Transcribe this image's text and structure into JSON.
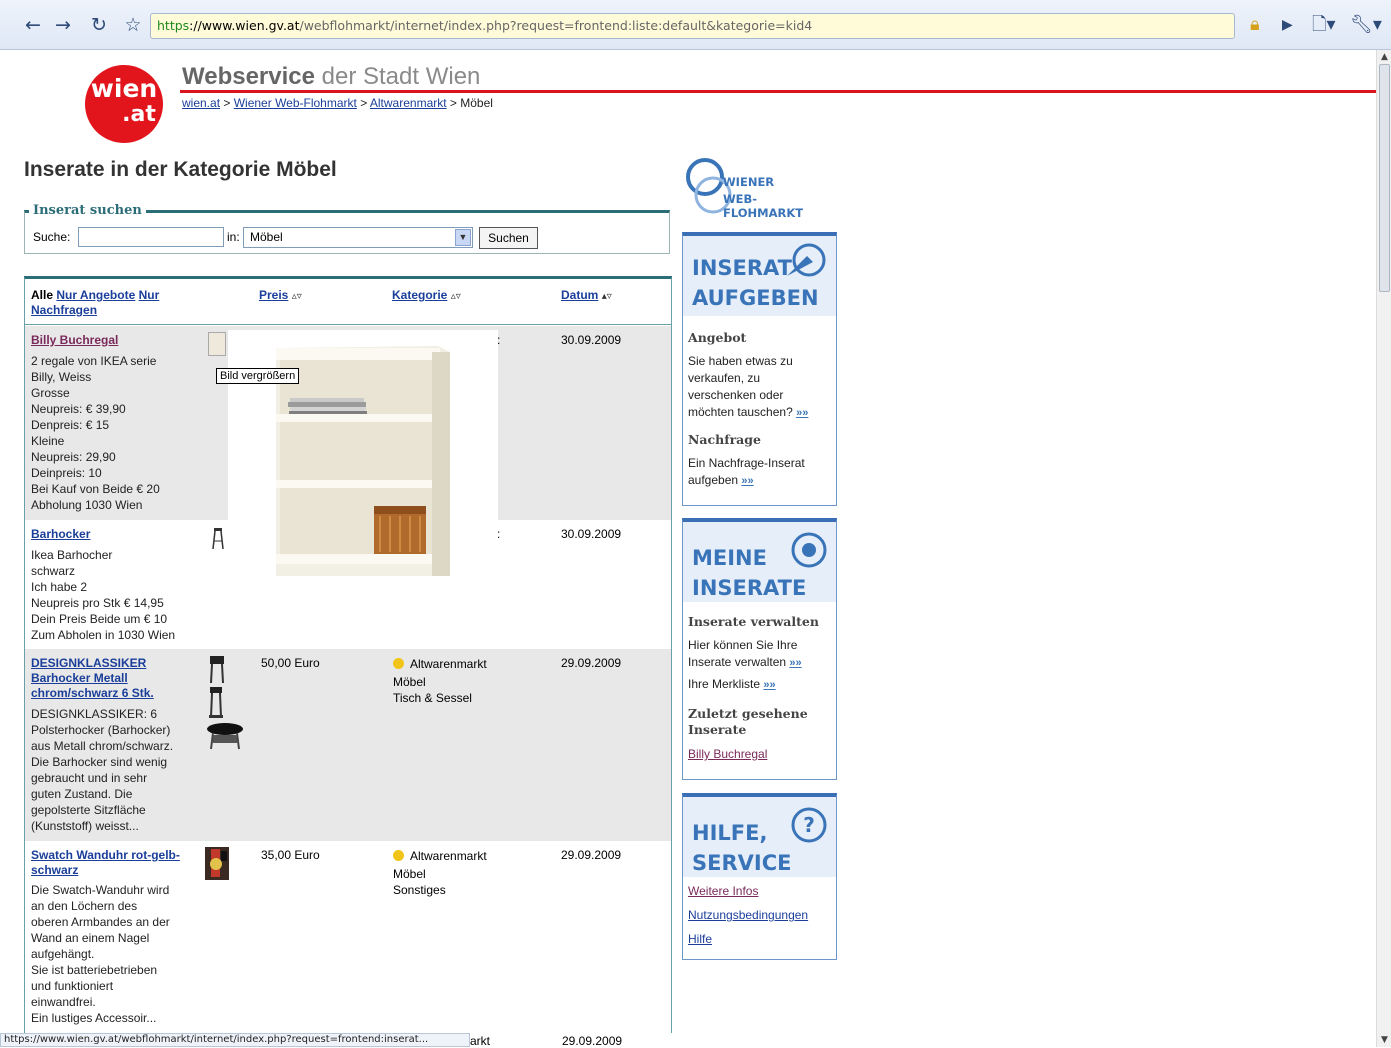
{
  "browser": {
    "url_scheme": "https",
    "url_host": "://www.wien.gv.at",
    "url_path": "/webflohmarkt/internet/index.php?request=frontend:liste:default&kategorie=kid4",
    "status_text": "https://www.wien.gv.at/webflohmarkt/internet/index.php?request=frontend:inserat..."
  },
  "header": {
    "logo_line1": "wien",
    "logo_line2": ".at",
    "title_bold": "Webservice",
    "title_rest": " der Stadt Wien",
    "breadcrumb": [
      "wien.at",
      "Wiener Web-Flohmarkt",
      "Altwarenmarkt",
      "Möbel"
    ]
  },
  "page_title": "Inserate in der Kategorie Möbel",
  "search": {
    "legend": "Inserat suchen",
    "label": "Suche:",
    "value": "",
    "in_label": "in:",
    "category": "Möbel",
    "button": "Suchen"
  },
  "listing": {
    "head": {
      "all": "Alle",
      "only_offers": "Nur Angebote",
      "only_requests": "Nur Nachfragen",
      "price": "Preis",
      "category": "Kategorie",
      "date": "Datum",
      "sort_glyph": "▵▿",
      "sort_glyph_active": "▴▿"
    },
    "rows": [
      {
        "title": "Billy Buchregal",
        "desc": "2 regale von IKEA serie\nBilly, Weiss\nGrosse\nNeupreis: € 39,90\nDenpreis: € 15\nKleine\nNeupreis: 29,90\nDeinpreis: 10\nBei Kauf von Beide € 20\nAbholung 1030 Wien",
        "price": "",
        "market": "",
        "cat1": "",
        "cat2": "",
        "date": "30.09.2009"
      },
      {
        "title": "Barhocker",
        "desc": "Ikea Barhocher\nschwarz\nIch habe 2\nNeupreis pro Stk € 14,95\nDein Preis Beide um € 10\nZum Abholen in 1030 Wien",
        "price": "",
        "market": "",
        "cat1": "",
        "cat2": "",
        "date": "30.09.2009"
      },
      {
        "title": "DESIGNKLASSIKER Barhocker Metall chrom/schwarz 6 Stk.",
        "desc": "DESIGNKLASSIKER: 6\nPolsterhocker (Barhocker)\naus Metall chrom/schwarz.\nDie Barhocker sind wenig\ngebraucht und in sehr\nguten Zustand. Die\ngepolsterte Sitzfläche\n(Kunststoff) weisst...",
        "price": "50,00 Euro",
        "market": "Altwarenmarkt",
        "cat1": "Möbel",
        "cat2": "Tisch & Sessel",
        "date": "29.09.2009"
      },
      {
        "title": "Swatch Wanduhr rot-gelb-schwarz",
        "desc": "Die Swatch-Wanduhr wird\nan den Löchern des\noberen Armbandes an der\nWand an einem Nagel\naufgehängt.\nSie ist batteriebetrieben\nund funktioniert\neinwandfrei.\nEin lustiges Accessoir...",
        "price": "35,00 Euro",
        "market": "Altwarenmarkt",
        "cat1": "Möbel",
        "cat2": "Sonstiges",
        "date": "29.09.2009"
      }
    ],
    "row5_partial_market": "arkt",
    "row5_partial_date": "29.09.2009",
    "row1_extra": ":",
    "row2_extra": ":"
  },
  "popup": {
    "tooltip": "Bild vergrößern"
  },
  "sidebar": {
    "logo_line1": "WIENER",
    "logo_line2": "WEB-FLOHMARKT",
    "inserat": {
      "title1": "INSERAT",
      "title2": "AUFGEBEN",
      "offer_heading": "Angebot",
      "offer_text": "Sie haben etwas zu verkaufen, zu verschenken oder möchten tauschen?",
      "request_heading": "Nachfrage",
      "request_text": "Ein Nachfrage-Inserat aufgeben"
    },
    "meine": {
      "title1": "MEINE",
      "title2": "INSERATE",
      "manage_heading": "Inserate verwalten",
      "manage_text": "Hier können Sie Ihre Inserate verwalten",
      "watchlist": "Ihre Merkliste",
      "recent_heading": "Zuletzt gesehene Inserate",
      "recent_link": "Billy Buchregal"
    },
    "hilfe": {
      "title1": "HILFE,",
      "title2": "SERVICE",
      "links": [
        "Weitere Infos",
        "Nutzungsbedingungen",
        "Hilfe"
      ]
    },
    "more_glyph": "»»"
  }
}
